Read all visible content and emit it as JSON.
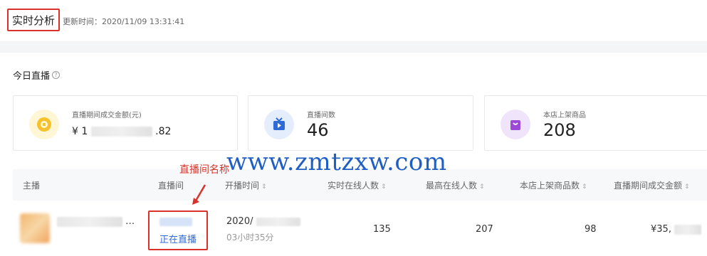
{
  "header": {
    "title": "实时分析",
    "update_time": "更新时间：2020/11/09 13:31:41"
  },
  "today": {
    "section_title": "今日直播",
    "cards": [
      {
        "label": "直播期间成交金额(元)",
        "value_prefix": "¥ 1",
        "value_suffix": ".82",
        "icon": "coin-icon",
        "color": "#f7c12b"
      },
      {
        "label": "直播间数",
        "value": "46",
        "icon": "tv-icon",
        "color": "#2f6bd6"
      },
      {
        "label": "本店上架商品",
        "value": "208",
        "icon": "shopping-bag-icon",
        "color": "#9b4ad6"
      }
    ]
  },
  "watermark": "www.zmtzxw.com",
  "annotation": "直播间名称",
  "table": {
    "columns": [
      "主播",
      "直播间",
      "开播时间",
      "实时在线人数",
      "最高在线人数",
      "本店上架商品数",
      "直播期间成交金额"
    ],
    "rows": [
      {
        "anchor": "",
        "room_status": "正在直播",
        "start_date": "2020/",
        "duration": "03小时35分",
        "online_now": "135",
        "online_peak": "207",
        "products": "98",
        "sales": "¥35,"
      }
    ]
  },
  "colors": {
    "accent": "#2f6bd6",
    "highlight": "#d9322b"
  }
}
